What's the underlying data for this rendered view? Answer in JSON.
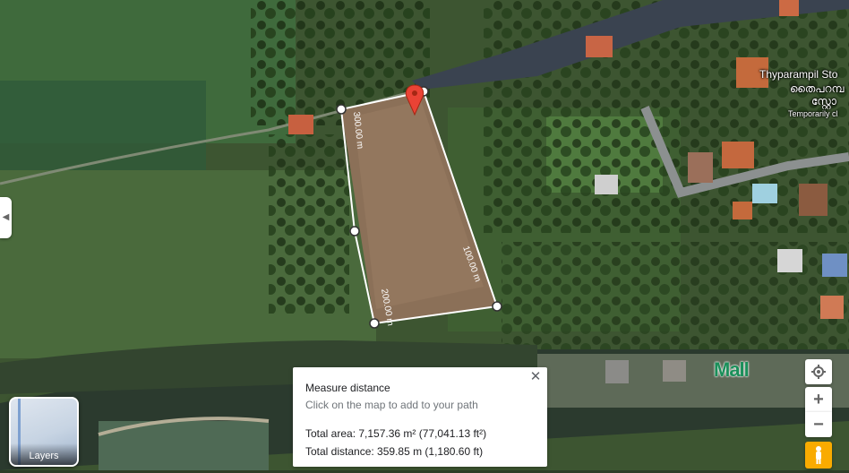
{
  "map": {
    "place_label": "Thyparampil Sto",
    "place_label_local": "തൈപറമ്പ",
    "place_label_local2": "സ്റ്റോ",
    "place_status": "Temporarily cl",
    "mall_label": "Mall"
  },
  "measure_path": {
    "distance_labels": [
      "300.00 m",
      "100.00 m",
      "200.00 m"
    ]
  },
  "layers": {
    "label": "Layers"
  },
  "measure_card": {
    "title": "Measure distance",
    "hint": "Click on the map to add to your path",
    "total_area": "Total area: 7,157.36 m² (77,041.13 ft²)",
    "total_distance": "Total distance: 359.85 m (1,180.60 ft)"
  },
  "controls": {
    "zoom_in": "+",
    "zoom_out": "−"
  },
  "colors": {
    "accent_marker": "#ea4335",
    "path": "#ffffff",
    "mall_green": "#1b8f5a"
  }
}
